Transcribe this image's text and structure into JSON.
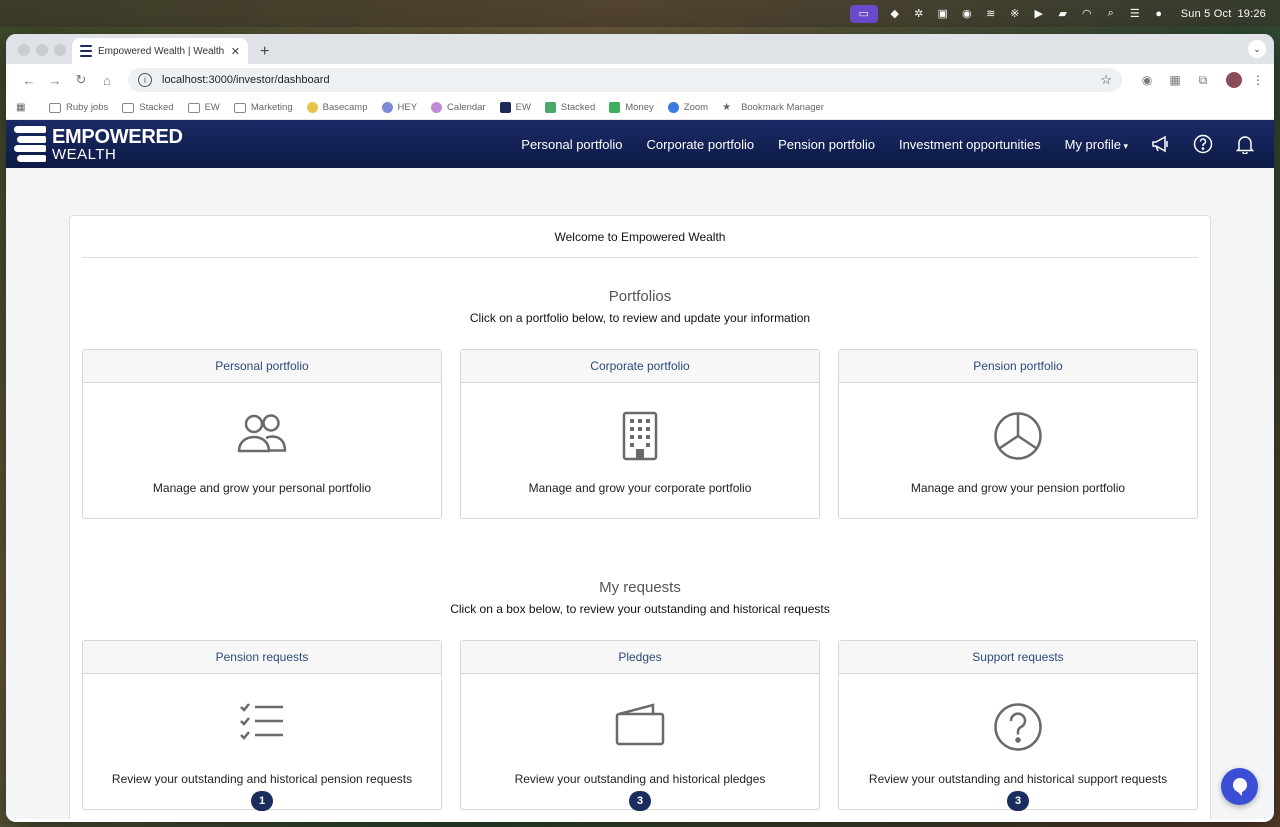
{
  "menubar": {
    "date": "Sun 5 Oct",
    "time": "19:26"
  },
  "browser": {
    "tab_title": "Empowered Wealth | Wealth I",
    "url": "localhost:3000/investor/dashboard",
    "bookmarks": [
      {
        "label": "Ruby jobs",
        "icon": "folder-icon"
      },
      {
        "label": "Stacked",
        "icon": "folder-icon"
      },
      {
        "label": "EW",
        "icon": "folder-icon"
      },
      {
        "label": "Marketing",
        "icon": "folder-icon"
      },
      {
        "label": "Basecamp",
        "icon": "basecamp-icon"
      },
      {
        "label": "HEY",
        "icon": "hey-icon"
      },
      {
        "label": "Calendar",
        "icon": "calendar-icon"
      },
      {
        "label": "EW",
        "icon": "ew-icon"
      },
      {
        "label": "Stacked",
        "icon": "stacked-icon"
      },
      {
        "label": "Money",
        "icon": "money-icon"
      },
      {
        "label": "Zoom",
        "icon": "zoom-icon"
      },
      {
        "label": "Bookmark Manager",
        "icon": "star-icon"
      }
    ]
  },
  "site": {
    "logo_line1": "EMPOWERED",
    "logo_line2": "WEALTH",
    "nav": {
      "personal": "Personal portfolio",
      "corporate": "Corporate portfolio",
      "pension": "Pension portfolio",
      "investment": "Investment opportunities",
      "profile": "My profile"
    }
  },
  "dashboard": {
    "welcome": "Welcome to Empowered Wealth",
    "portfolios": {
      "title": "Portfolios",
      "subtitle": "Click on a portfolio below, to review and update your information",
      "boxes": [
        {
          "title": "Personal portfolio",
          "text": "Manage and grow your personal portfolio",
          "icon": "people-icon"
        },
        {
          "title": "Corporate portfolio",
          "text": "Manage and grow your corporate portfolio",
          "icon": "building-icon"
        },
        {
          "title": "Pension portfolio",
          "text": "Manage and grow your pension portfolio",
          "icon": "pie-chart-icon"
        }
      ]
    },
    "requests": {
      "title": "My requests",
      "subtitle": "Click on a box below, to review your outstanding and historical requests",
      "boxes": [
        {
          "title": "Pension requests",
          "text": "Review your outstanding and historical pension requests",
          "count": "1",
          "icon": "checklist-icon"
        },
        {
          "title": "Pledges",
          "text": "Review your outstanding and historical pledges",
          "count": "3",
          "icon": "wallet-icon"
        },
        {
          "title": "Support requests",
          "text": "Review your outstanding and historical support requests",
          "count": "3",
          "icon": "question-circle-icon"
        }
      ]
    }
  },
  "colors": {
    "nav_bg": "#0d1a45",
    "box_title": "#2d4a7a",
    "badge": "#1b2d5e",
    "chat": "#3a4fd6"
  }
}
